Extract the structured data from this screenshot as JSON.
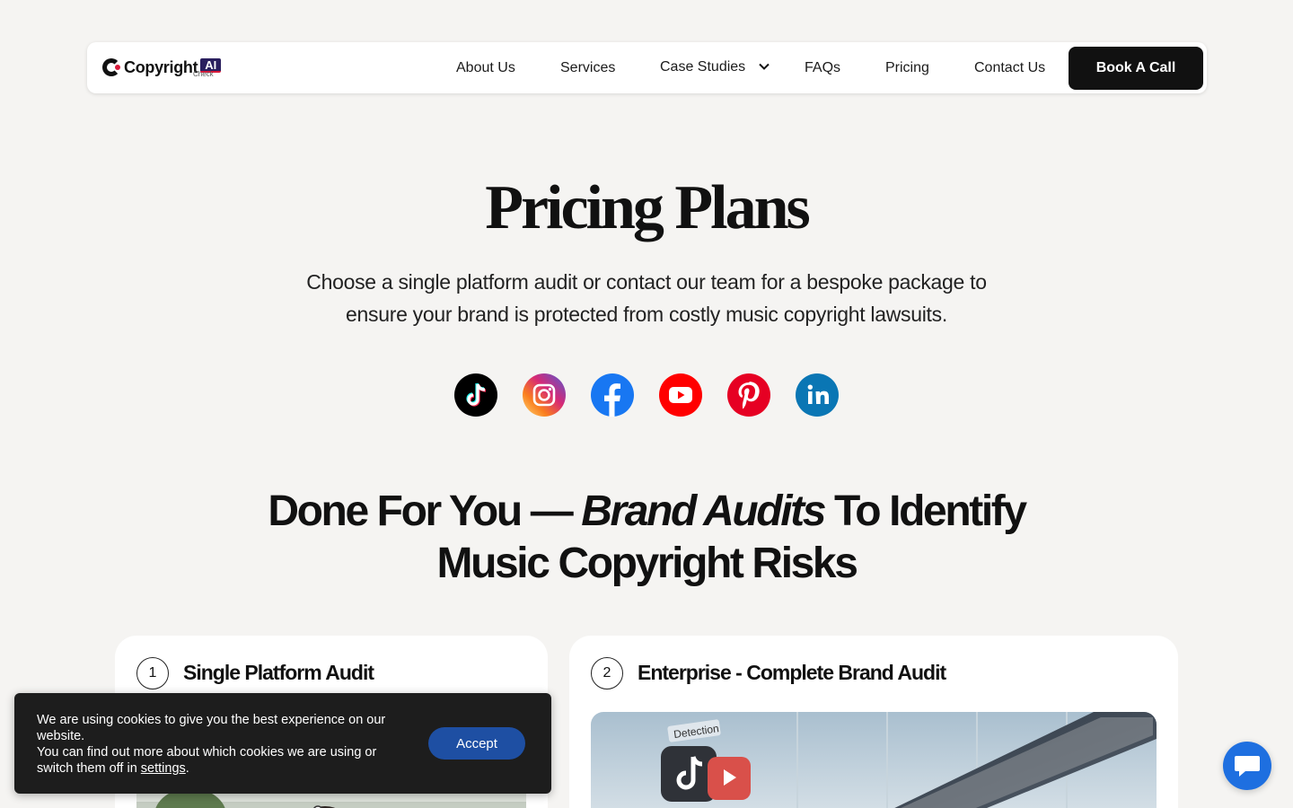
{
  "brand": {
    "name": "Copyright",
    "badge": "AI",
    "sub": "Check"
  },
  "nav": {
    "links": [
      {
        "label": "About Us"
      },
      {
        "label": "Services"
      },
      {
        "label": "Case Studies"
      },
      {
        "label": "FAQs"
      },
      {
        "label": "Pricing"
      },
      {
        "label": "Contact Us"
      }
    ],
    "cta": "Book A Call"
  },
  "hero": {
    "title": "Pricing Plans",
    "subtitle": "Choose a single platform audit or contact our team for a bespoke package to ensure your brand is protected from costly music copyright lawsuits."
  },
  "socials": [
    {
      "name": "tiktok-icon",
      "color": "#000000"
    },
    {
      "name": "instagram-icon",
      "color": "#dd2a7b"
    },
    {
      "name": "facebook-icon",
      "color": "#1877f2"
    },
    {
      "name": "youtube-icon",
      "color": "#ff0000"
    },
    {
      "name": "pinterest-icon",
      "color": "#e60023"
    },
    {
      "name": "linkedin-icon",
      "color": "#0a66c2"
    }
  ],
  "section": {
    "title_part1": "Done For You — ",
    "title_em": "Brand Audits",
    "title_part2": " To Identify Music Copyright Risks"
  },
  "cards": [
    {
      "number": "1",
      "title": "Single Platform Audit"
    },
    {
      "number": "2",
      "title": "Enterprise - Complete Brand Audit",
      "image_label": "Detection"
    }
  ],
  "cookie": {
    "line1": "We are using cookies to give you the best experience on our website.",
    "line2": "You can find out more about which cookies we are using or switch them off in ",
    "link": "settings",
    "end": ".",
    "accept": "Accept"
  }
}
